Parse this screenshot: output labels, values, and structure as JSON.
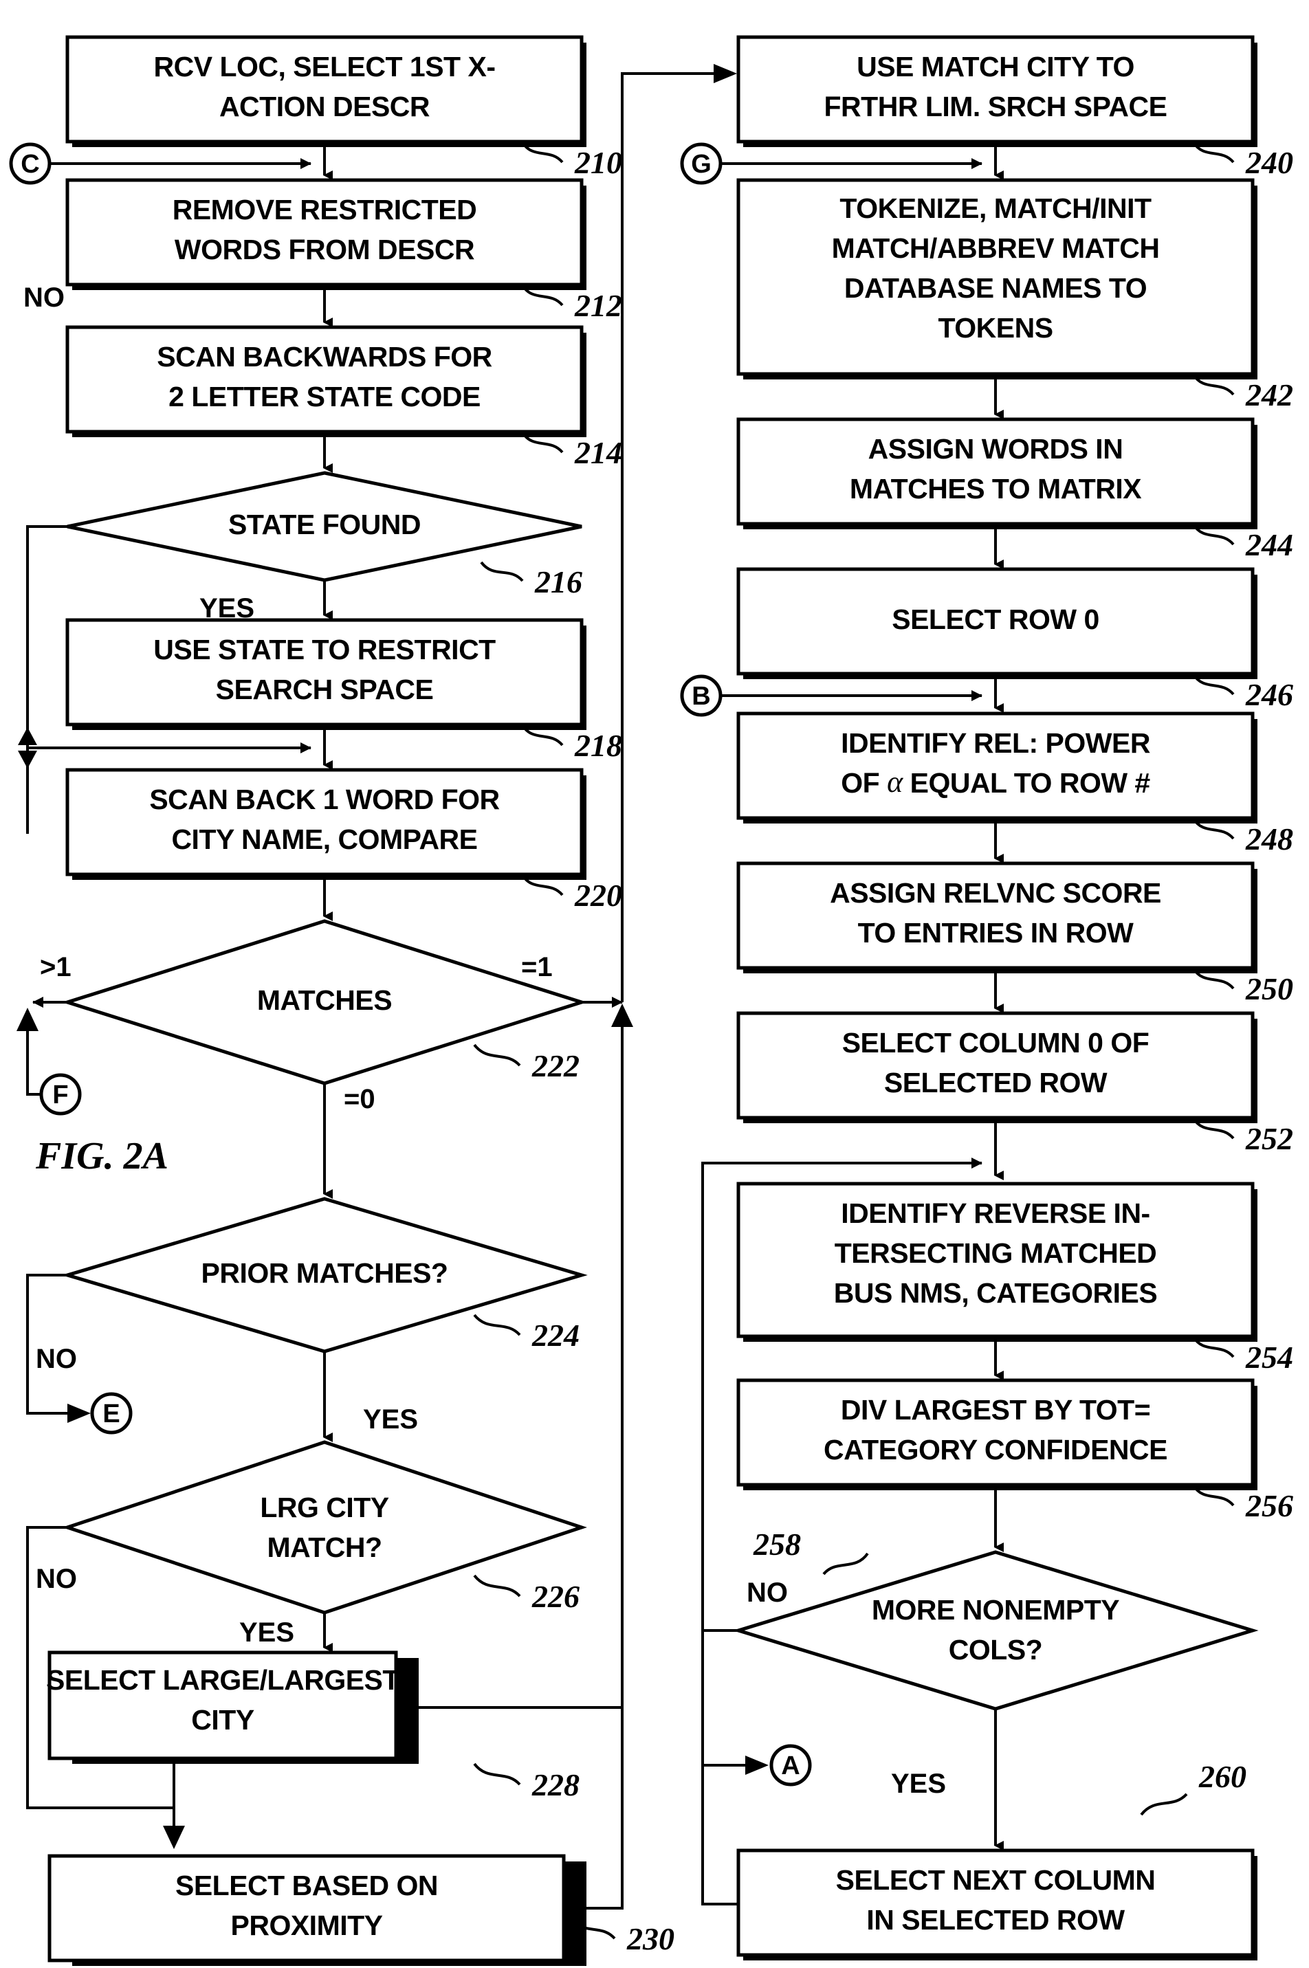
{
  "figure": {
    "label": "FIG. 2A"
  },
  "boxes": [
    {
      "id": "210",
      "ref": "210",
      "lines": [
        "RCV LOC, SELECT 1ST  X-",
        "ACTION DESCR"
      ]
    },
    {
      "id": "212",
      "ref": "212",
      "lines": [
        "REMOVE RESTRICTED",
        "WORDS FROM DESCR"
      ]
    },
    {
      "id": "214",
      "ref": "214",
      "lines": [
        "SCAN BACKWARDS FOR",
        "2 LETTER STATE CODE"
      ]
    },
    {
      "id": "216",
      "ref": "216",
      "lines": [
        "STATE FOUND"
      ]
    },
    {
      "id": "218",
      "ref": "218",
      "lines": [
        "USE STATE TO RESTRICT",
        "SEARCH SPACE"
      ]
    },
    {
      "id": "220",
      "ref": "220",
      "lines": [
        "SCAN BACK 1 WORD FOR",
        "CITY NAME, COMPARE"
      ]
    },
    {
      "id": "222",
      "ref": "222",
      "lines": [
        "MATCHES"
      ]
    },
    {
      "id": "224",
      "ref": "224",
      "lines": [
        "PRIOR MATCHES?"
      ]
    },
    {
      "id": "226",
      "ref": "226",
      "lines": [
        "LRG CITY",
        "MATCH?"
      ]
    },
    {
      "id": "228",
      "ref": "228",
      "lines": [
        "SELECT LARGE/LARGEST",
        "CITY"
      ]
    },
    {
      "id": "230",
      "ref": "230",
      "lines": [
        "SELECT BASED ON",
        "PROXIMITY"
      ]
    },
    {
      "id": "240",
      "ref": "240",
      "lines": [
        "USE MATCH CITY TO",
        "FRTHR LIM. SRCH SPACE"
      ]
    },
    {
      "id": "242",
      "ref": "242",
      "lines": [
        "TOKENIZE, MATCH/INIT",
        "MATCH/ABBREV MATCH",
        "DATABASE NAMES  TO",
        "TOKENS"
      ]
    },
    {
      "id": "244",
      "ref": "244",
      "lines": [
        "ASSIGN WORDS IN",
        "MATCHES TO MATRIX"
      ]
    },
    {
      "id": "246",
      "ref": "246",
      "lines": [
        "SELECT ROW 0"
      ]
    },
    {
      "id": "248",
      "ref": "248",
      "lines": [
        "IDENTIFY REL: POWER",
        "OF α EQUAL TO ROW #"
      ]
    },
    {
      "id": "250",
      "ref": "250",
      "lines": [
        "ASSIGN RELVNC SCORE",
        "TO ENTRIES IN ROW"
      ]
    },
    {
      "id": "252",
      "ref": "252",
      "lines": [
        "SELECT COLUMN 0 OF",
        "SELECTED ROW"
      ]
    },
    {
      "id": "254",
      "ref": "254",
      "lines": [
        "IDENTIFY REVERSE IN-",
        "TERSECTING MATCHED",
        "BUS NMS, CATEGORIES"
      ]
    },
    {
      "id": "256",
      "ref": "256",
      "lines": [
        "DIV LARGEST BY TOT=",
        "CATEGORY CONFIDENCE"
      ]
    },
    {
      "id": "258",
      "ref": "258",
      "lines": [
        "MORE NONEMPTY",
        "COLS?"
      ]
    },
    {
      "id": "260",
      "ref": "260",
      "lines": [
        "SELECT NEXT COLUMN",
        "IN SELECTED ROW"
      ]
    }
  ],
  "box_text": {
    "b210_l1": "RCV LOC, SELECT 1ST  X-",
    "b210_l2": "ACTION DESCR",
    "b212_l1": "REMOVE RESTRICTED",
    "b212_l2": "WORDS FROM DESCR",
    "b214_l1": "SCAN BACKWARDS FOR",
    "b214_l2": "2 LETTER STATE CODE",
    "b216_l1": "STATE FOUND",
    "b218_l1": "USE STATE TO RESTRICT",
    "b218_l2": "SEARCH SPACE",
    "b220_l1": "SCAN BACK 1 WORD FOR",
    "b220_l2": "CITY NAME, COMPARE",
    "b222_l1": "MATCHES",
    "b224_l1": "PRIOR MATCHES?",
    "b226_l1": "LRG CITY",
    "b226_l2": "MATCH?",
    "b228_l1": "SELECT LARGE/LARGEST",
    "b228_l2": "CITY",
    "b230_l1": "SELECT BASED ON",
    "b230_l2": "PROXIMITY",
    "b240_l1": "USE MATCH CITY TO",
    "b240_l2": "FRTHR LIM. SRCH SPACE",
    "b242_l1": "TOKENIZE, MATCH/INIT",
    "b242_l2": "MATCH/ABBREV MATCH",
    "b242_l3": "DATABASE NAMES  TO",
    "b242_l4": "TOKENS",
    "b244_l1": "ASSIGN WORDS IN",
    "b244_l2": "MATCHES TO MATRIX",
    "b246_l1": "SELECT ROW 0",
    "b248_l1": "IDENTIFY REL: POWER",
    "b248_l2a": "OF ",
    "b248_l2b": "α",
    "b248_l2c": " EQUAL TO ROW #",
    "b250_l1": "ASSIGN RELVNC SCORE",
    "b250_l2": "TO ENTRIES IN ROW",
    "b252_l1": "SELECT COLUMN 0 OF",
    "b252_l2": "SELECTED ROW",
    "b254_l1": "IDENTIFY REVERSE IN-",
    "b254_l2": "TERSECTING MATCHED",
    "b254_l3": "BUS NMS, CATEGORIES",
    "b256_l1": "DIV LARGEST BY TOT=",
    "b256_l2": "CATEGORY CONFIDENCE",
    "b258_l1": "MORE NONEMPTY",
    "b258_l2": "COLS?",
    "b260_l1": "SELECT NEXT COLUMN",
    "b260_l2": "IN SELECTED ROW"
  },
  "ref_numbers": {
    "r210": "210",
    "r212": "212",
    "r214": "214",
    "r216": "216",
    "r218": "218",
    "r220": "220",
    "r222": "222",
    "r224": "224",
    "r226": "226",
    "r228": "228",
    "r230": "230",
    "r240": "240",
    "r242": "242",
    "r244": "244",
    "r246": "246",
    "r248": "248",
    "r250": "250",
    "r252": "252",
    "r254": "254",
    "r256": "256",
    "r258": "258",
    "r260": "260"
  },
  "edge_labels": {
    "e216_no": "NO",
    "e216_yes": "YES",
    "e222_gt1": ">1",
    "e222_eq1": "=1",
    "e222_eq0": "=0",
    "e224_no": "NO",
    "e224_yes": "YES",
    "e226_no": "NO",
    "e226_yes": "YES",
    "e258_no": "NO",
    "e258_yes": "YES"
  },
  "connectors": {
    "c": "C",
    "f": "F",
    "e": "E",
    "g": "G",
    "b": "B",
    "a": "A"
  },
  "colors": {
    "ink": "#000000",
    "paper": "#ffffff"
  }
}
